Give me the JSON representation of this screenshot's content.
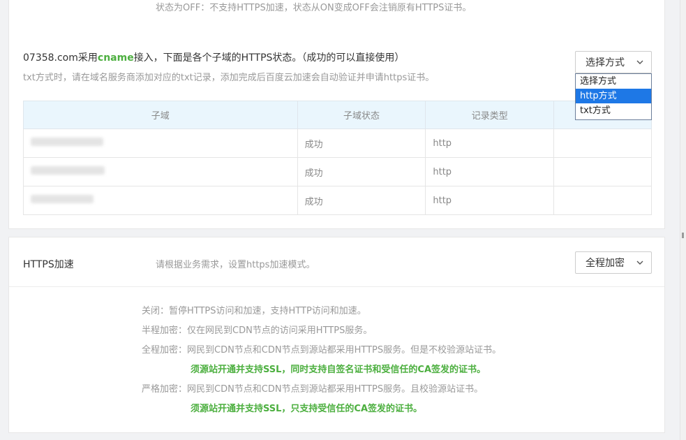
{
  "top_panel": {
    "status_off_text": "状态为OFF：不支持HTTPS加速，状态从ON变成OFF会注销原有HTTPS证书。",
    "cname_title": {
      "prefix": "07358.com采用",
      "highlight": "cname",
      "suffix": "接入，下面是各个子域的HTTPS状态。（成功的可以直接使用）"
    },
    "txt_hint": "txt方式时，请在域名服务商添加对应的txt记录，添加完成后百度云加速会自动验证并申请https证书。",
    "method_select": {
      "selected": "选择方式",
      "options": [
        "选择方式",
        "http方式",
        "txt方式"
      ],
      "highlighted_option": "http方式"
    },
    "table": {
      "headers": [
        "子域",
        "子域状态",
        "记录类型",
        ""
      ],
      "rows": [
        {
          "subdomain": "",
          "status": "成功",
          "record_type": "http",
          "action": ""
        },
        {
          "subdomain": "",
          "status": "成功",
          "record_type": "http",
          "action": ""
        },
        {
          "subdomain": "",
          "status": "成功",
          "record_type": "http",
          "action": ""
        }
      ]
    }
  },
  "https_panel": {
    "label": "HTTPS加速",
    "description": "请根据业务需求，设置https加速模式。",
    "mode_select": {
      "selected": "全程加密"
    },
    "mode_descriptions": [
      {
        "text": "关闭：暂停HTTPS访问和加速，支持HTTP访问和加速。",
        "emphasis": false
      },
      {
        "text": "半程加密：仅在网民到CDN节点的访问采用HTTPS服务。",
        "emphasis": false
      },
      {
        "text": "全程加密：网民到CDN节点和CDN节点到源站都采用HTTPS服务。但是不校验源站证书。",
        "emphasis": false
      },
      {
        "text": "须源站开通并支持SSL，同时支持自签名证书和受信任的CA签发的证书。",
        "emphasis": true
      },
      {
        "text": "严格加密：网民到CDN节点和CDN节点到源站都采用HTTPS服务。且校验源站证书。",
        "emphasis": false
      },
      {
        "text": "须源站开通并支持SSL，只支持受信任的CA签发的证书。",
        "emphasis": true
      }
    ]
  },
  "colors": {
    "accent_green": "#4caf3f",
    "selection_blue": "#1e78e6",
    "table_header_bg": "#eaf6fd"
  },
  "icons": {
    "select_arrow": "chevron-down-icon"
  }
}
